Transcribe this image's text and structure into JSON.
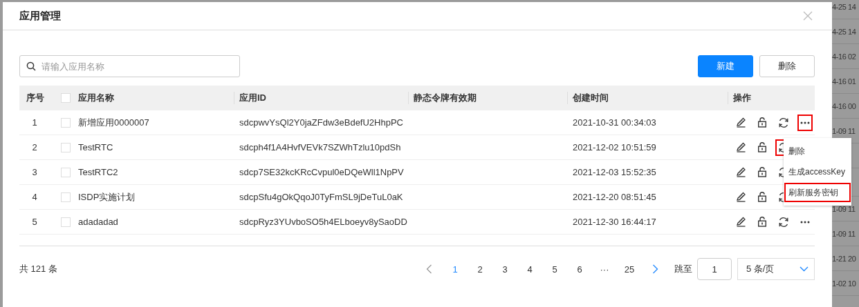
{
  "background_rows_top": [
    "4-25 14",
    "4-25 14",
    "4-16 02",
    "4-16 01",
    "4-16 00",
    "1-09 11"
  ],
  "background_rows_bottom": [
    "1-09 11",
    "1-09 11",
    "1-21 20",
    "1-02 10"
  ],
  "dialog": {
    "title": "应用管理"
  },
  "search": {
    "placeholder": "请输入应用名称"
  },
  "buttons": [
    {
      "label": "新建",
      "kind": "primary"
    },
    {
      "label": "删除",
      "kind": "default"
    }
  ],
  "table": {
    "columns": [
      "序号",
      "应用名称",
      "应用ID",
      "静态令牌有效期",
      "创建时间",
      "操作"
    ],
    "header_checked": false,
    "rows": [
      {
        "index": "1",
        "checked": false,
        "name": "新增应用0000007",
        "app_id": "sdcpwvYsQl2Y0jaZFdw3eBdefU2HhpPC",
        "created": "2021-10-31 00:34:03",
        "actions": [
          {
            "kind": "edit",
            "highlighted": false
          },
          {
            "kind": "lock",
            "highlighted": false
          },
          {
            "kind": "refresh",
            "highlighted": false
          },
          {
            "kind": "more",
            "highlighted": true
          }
        ]
      },
      {
        "index": "2",
        "checked": false,
        "name": "TestRTC",
        "app_id": "sdcph4f1A4HvfVEVk7SZWhTzlu10pdSh",
        "created": "2021-12-02 10:51:59",
        "actions": [
          {
            "kind": "edit",
            "highlighted": false
          },
          {
            "kind": "lock",
            "highlighted": false
          },
          {
            "kind": "refresh",
            "highlighted": true
          }
        ]
      },
      {
        "index": "3",
        "checked": false,
        "name": "TestRTC2",
        "app_id": "sdcp7SE32kcKRcCvpul0eDQeWll1NpPV",
        "created": "2021-12-03 15:52:35",
        "actions": [
          {
            "kind": "edit",
            "highlighted": false
          },
          {
            "kind": "lock",
            "highlighted": false
          },
          {
            "kind": "refresh",
            "highlighted": false
          }
        ]
      },
      {
        "index": "4",
        "checked": false,
        "name": "ISDP实施计划",
        "app_id": "sdcpSfu4gOkQqoJ0TyFmSL9jDeTuL0aK",
        "created": "2021-12-20 08:51:45",
        "actions": [
          {
            "kind": "edit",
            "highlighted": false
          },
          {
            "kind": "lock",
            "highlighted": false
          },
          {
            "kind": "refresh",
            "highlighted": false
          }
        ]
      },
      {
        "index": "5",
        "checked": false,
        "name": "adadadad",
        "app_id": "sdcpRyz3YUvboSO5h4ELboeyv8ySaoDD",
        "created": "2021-12-30 16:44:17",
        "actions": [
          {
            "kind": "edit",
            "highlighted": false
          },
          {
            "kind": "lock",
            "highlighted": false
          },
          {
            "kind": "refresh",
            "highlighted": false
          },
          {
            "kind": "more",
            "highlighted": false
          }
        ]
      }
    ]
  },
  "menu": {
    "items": [
      {
        "label": "删除",
        "highlighted": false
      },
      {
        "label": "生成accessKey",
        "highlighted": false
      },
      {
        "label": "刷新服务密钥",
        "highlighted": true
      }
    ]
  },
  "pagination": {
    "total": "共 121 条",
    "prev_disabled": true,
    "next_disabled": false,
    "pages": [
      {
        "label": "1",
        "selected": true
      },
      {
        "label": "2",
        "selected": false
      },
      {
        "label": "3",
        "selected": false
      },
      {
        "label": "4",
        "selected": false
      },
      {
        "label": "5",
        "selected": false
      },
      {
        "label": "6",
        "selected": false
      },
      {
        "label": "···",
        "selected": false
      },
      {
        "label": "25",
        "selected": false
      }
    ],
    "jump_label": "跳至",
    "jump_value": "1",
    "page_size": "5 条/页"
  }
}
